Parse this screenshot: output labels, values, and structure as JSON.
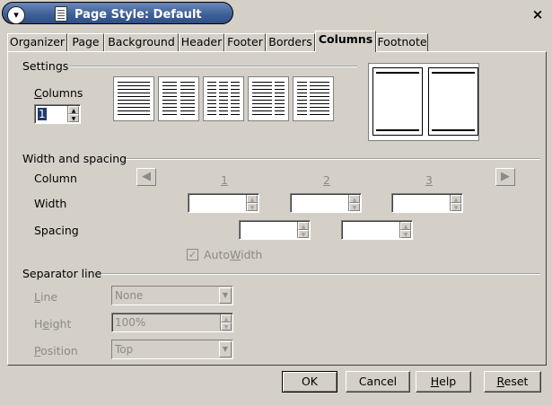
{
  "window": {
    "title": "Page Style: Default",
    "menu_glyph": "▾",
    "close_glyph": "×"
  },
  "tabs": [
    {
      "label": "Organizer"
    },
    {
      "label": "Page"
    },
    {
      "label": "Background"
    },
    {
      "label": "Header"
    },
    {
      "label": "Footer"
    },
    {
      "label": "Borders"
    },
    {
      "label": "Columns",
      "active": true
    },
    {
      "label": "Footnote"
    }
  ],
  "settings": {
    "group_label": "Settings",
    "columns_label": "Columns",
    "columns_value": "1"
  },
  "width_spacing": {
    "group_label": "Width and spacing",
    "column_label": "Column",
    "width_label": "Width",
    "spacing_label": "Spacing",
    "col_numbers": [
      "1",
      "2",
      "3"
    ],
    "prev_glyph": "◀",
    "next_glyph": "▶",
    "autowidth_label": "AutoWidth",
    "autowidth_checked": true,
    "checkmark": "✓"
  },
  "separator": {
    "group_label": "Separator line",
    "line_label": "Line",
    "line_value": "None",
    "height_label": "Height",
    "height_value": "100%",
    "position_label": "Position",
    "position_value": "Top"
  },
  "buttons": {
    "ok": "OK",
    "cancel": "Cancel",
    "help": "Help",
    "reset": "Reset"
  },
  "icons": {
    "spin_up": "▲",
    "spin_down": "▼",
    "dropdown": "▼"
  }
}
